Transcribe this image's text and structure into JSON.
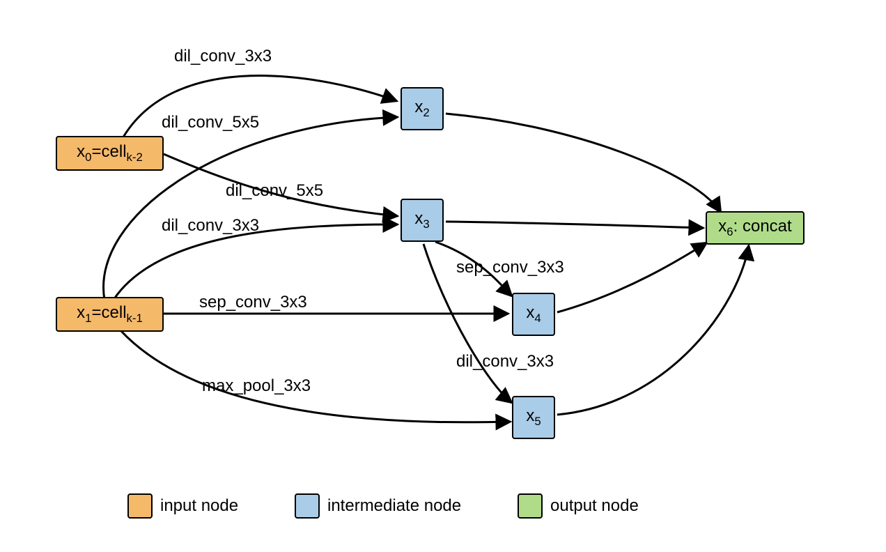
{
  "nodes": {
    "x0": {
      "label_main": "x",
      "label_sub": "0",
      "suffix": "=cell",
      "suffix_sub": "k-2"
    },
    "x1": {
      "label_main": "x",
      "label_sub": "1",
      "suffix": "=cell",
      "suffix_sub": "k-1"
    },
    "x2": {
      "label_main": "x",
      "label_sub": "2"
    },
    "x3": {
      "label_main": "x",
      "label_sub": "3"
    },
    "x4": {
      "label_main": "x",
      "label_sub": "4"
    },
    "x5": {
      "label_main": "x",
      "label_sub": "5"
    },
    "x6": {
      "label_main": "x",
      "label_sub": "6",
      "suffix": ": concat"
    }
  },
  "edges": {
    "e_x0_x2": "dil_conv_3x3",
    "e_x0_x3": "dil_conv_5x5",
    "e_x1_x2": "dil_conv_5x5",
    "e_x1_x3": "dil_conv_3x3",
    "e_x1_x4": "sep_conv_3x3",
    "e_x3_x4": "sep_conv_3x3",
    "e_x1_x5": "max_pool_3x3",
    "e_x3_x5": "dil_conv_3x3"
  },
  "legend": {
    "input": "input node",
    "intermediate": "intermediate node",
    "output": "output node"
  },
  "colors": {
    "input": "#f5b96a",
    "intermediate": "#a9cce8",
    "output": "#b0dc8a"
  }
}
